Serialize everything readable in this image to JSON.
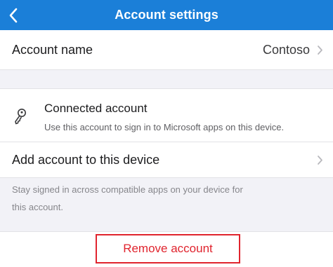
{
  "header": {
    "title": "Account settings"
  },
  "account_name": {
    "label": "Account name",
    "value": "Contoso"
  },
  "connected_account": {
    "title": "Connected account",
    "description": "Use this account to sign in to Microsoft apps on this device."
  },
  "add_account": {
    "label": "Add account to this device"
  },
  "footnote": {
    "line1": "Stay signed in across compatible apps on your device for",
    "line2": "this account."
  },
  "remove_account": {
    "label": "Remove account"
  },
  "colors": {
    "header_bg": "#1b7fd8",
    "destructive": "#e0242e",
    "background": "#f2f2f7"
  },
  "icons": {
    "back": "chevron-left-icon",
    "disclosure": "chevron-right-icon",
    "connected": "key-icon"
  }
}
